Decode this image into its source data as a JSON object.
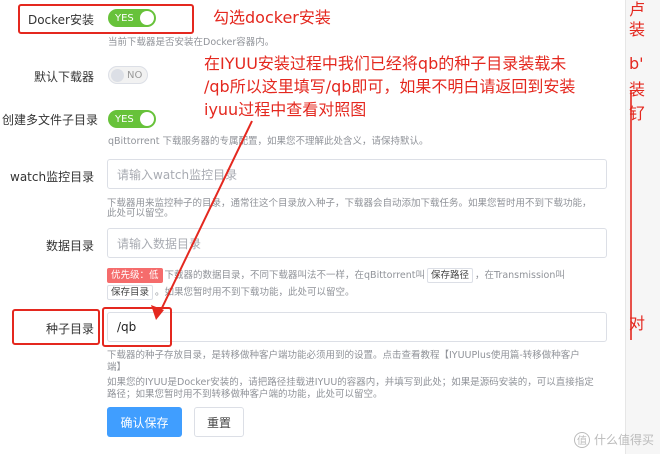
{
  "form": {
    "docker_install": {
      "label": "Docker安装",
      "switch_text": "YES",
      "help": "当前下载器是否安装在Docker容器内。"
    },
    "default_downloader": {
      "label": "默认下载器",
      "switch_text": "NO"
    },
    "multi_file_subdir": {
      "label": "创建多文件子目录",
      "switch_text": "YES",
      "help": "qBittorrent 下载服务器的专属配置，如果您不理解此处含义，请保持默认。"
    },
    "watch_dir": {
      "label": "watch监控目录",
      "placeholder": "请输入watch监控目录",
      "help_line1": "下载器用来监控种子的目录，通常往这个目录放入种子，下载器会自动添加下载任务。如果您暂时用不到下载功能，",
      "help_line2": "此处可以留空。"
    },
    "data_dir": {
      "label": "数据目录",
      "placeholder": "请输入数据目录",
      "priority_tag": "优先级：低",
      "help_part1": "下载器的数据目录，不同下载器叫法不一样，在qBittorrent叫",
      "tag_save_path": "保存路径",
      "help_part2": "，在Transmission叫",
      "tag_save_dir": "保存目录",
      "help_part3": "。如果您暂时用不到下载功能，此处可以留空。"
    },
    "seed_dir": {
      "label": "种子目录",
      "value": "/qb",
      "help_line1": "下载器的种子存放目录，是转移做种客户端功能必须用到的设置。点击查看教程【IYUUPlus使用篇-转移做种客户",
      "help_line2": "端】",
      "help_line3": "如果您的IYUU是Docker安装的，请把路径挂载进IYUU的容器内，并填写到此处；如果是源码安装的，可以直接指定",
      "help_line4": "路径；如果您暂时用不到转移做种客户端的功能，此处可以留空。"
    },
    "buttons": {
      "confirm": "确认保存",
      "reset": "重置"
    }
  },
  "annotations": {
    "docker_note": "勾选docker安装",
    "seed_note_line1": "在IYUU安装过程中我们已经将qb的种子目录装载未",
    "seed_note_line2": "/qb所以这里填写/qb即可，如果不明白请返回到安装",
    "seed_note_line3": "iyuu过程中查看对照图"
  },
  "sidebar_fragments": {
    "f1": "卢",
    "f2": "装",
    "f3": "b'",
    "f4": "装",
    "f5": "钌",
    "f6": "对"
  },
  "watermark": {
    "logo": "值",
    "text": "什么值得买"
  },
  "colors": {
    "annotation_red": "#e4281f",
    "switch_green": "#67c23a",
    "primary_blue": "#409eff",
    "priority_red": "#f56c6c"
  }
}
